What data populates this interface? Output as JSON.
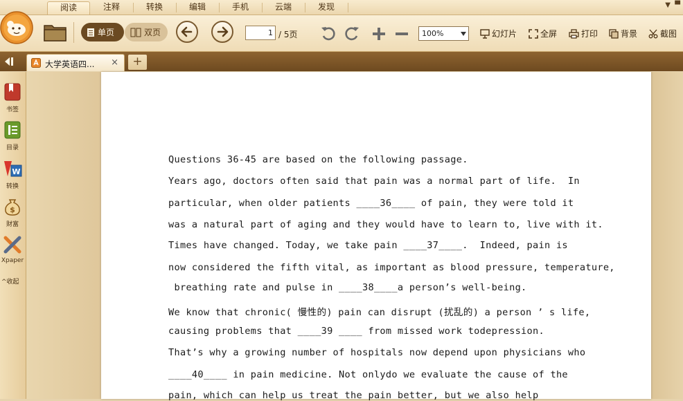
{
  "menu": {
    "items": [
      {
        "label": "阅读"
      },
      {
        "label": "注释"
      },
      {
        "label": "转换"
      },
      {
        "label": "编辑"
      },
      {
        "label": "手机"
      },
      {
        "label": "云端"
      },
      {
        "label": "发现"
      }
    ]
  },
  "toolbar": {
    "single_page": "单页",
    "double_page": "双页",
    "page_current": "1",
    "page_total": "/ 5页",
    "zoom": "100%",
    "slideshow": "幻灯片",
    "fullscreen": "全屏",
    "print": "打印",
    "background": "背景",
    "screenshot": "截图"
  },
  "tabs": {
    "active_title": "大学英语四...",
    "close": "×",
    "new": "+"
  },
  "sidebar": {
    "items": [
      {
        "label": "书签",
        "icon": "bookmark-icon"
      },
      {
        "label": "目录",
        "icon": "toc-icon"
      },
      {
        "label": "转换",
        "icon": "convert-icon"
      },
      {
        "label": "财富",
        "icon": "wealth-icon"
      },
      {
        "label": "Xpaper",
        "icon": "xpaper-icon"
      }
    ],
    "collapse": "收起"
  },
  "document": {
    "lines": [
      "Questions 36-45 are based on the following passage.",
      "Years ago, doctors often said that pain was a normal part of life.  In",
      "particular, when older patients ____36____ of pain, they were told it",
      "was a natural part of aging and they would have to learn to, live with it.",
      "Times have changed. Today, we take pain ____37____.  Indeed, pain is",
      "now considered the fifth vital, as important as blood pressure, temperature,",
      " breathing rate and pulse in ____38____a person’s well-being.",
      "We know that chronic( 慢性的) pain can disrupt (扰乱的) a person ’ s life,",
      "causing problems that ____39 ____ from missed work todepression.",
      "That’s why a growing number of hospitals now depend upon physicians who",
      "____40____ in pain medicine. Not onlydo we evaluate the cause of the",
      "pain, which can help us treat the pain better, but we also help"
    ]
  }
}
